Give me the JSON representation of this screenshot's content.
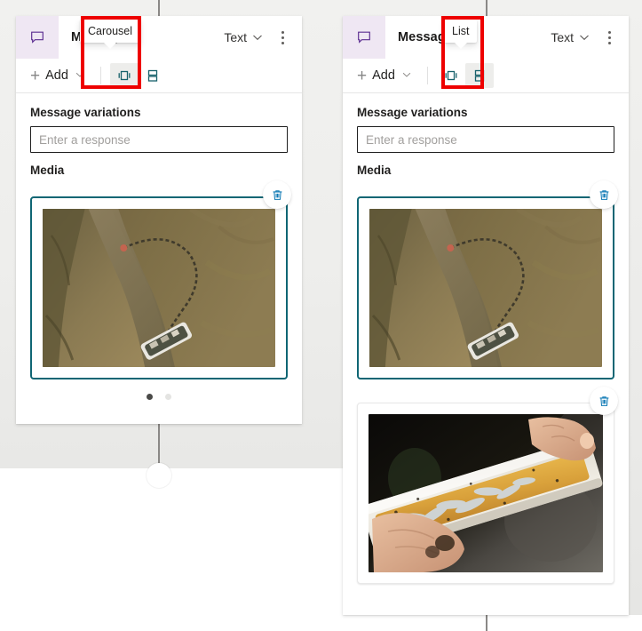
{
  "app": {
    "background_color": "#f1f1ef",
    "accent_teal": "#0f6674",
    "accent_blue": "#0078d4",
    "highlight_color": "#ee0000",
    "header_icon_bg": "#efe7f3",
    "header_icon_color": "#5c2e91"
  },
  "panels": [
    {
      "id": "left",
      "icon": "message-bubble-icon",
      "title": "Message",
      "type_label": "Text",
      "chevron_icon": "chevron-down-icon",
      "more_icon": "more-vertical-icon",
      "toolbar": {
        "add_label": "Add",
        "add_icon": "plus-icon",
        "add_chevron_icon": "chevron-down-icon",
        "carousel_icon": "carousel-layout-icon",
        "list_icon": "list-layout-icon",
        "selected_layout": "carousel"
      },
      "tooltip": {
        "text": "Carousel",
        "target": "carousel-layout-button"
      },
      "fields": {
        "variations_label": "Message variations",
        "response_value": "",
        "response_placeholder": "Enter a response",
        "media_label": "Media"
      },
      "media": [
        {
          "alt": "Aerial view of a fishing net curving from a sandy riverbank out to a small boat in brown water",
          "delete_icon": "trash-icon",
          "delete_label": "Delete",
          "selected": true
        }
      ],
      "pager": {
        "total": 2,
        "active_index": 0
      }
    },
    {
      "id": "right",
      "icon": "message-bubble-icon",
      "title": "Message",
      "type_label": "Text",
      "chevron_icon": "chevron-down-icon",
      "more_icon": "more-vertical-icon",
      "toolbar": {
        "add_label": "Add",
        "add_icon": "plus-icon",
        "add_chevron_icon": "chevron-down-icon",
        "carousel_icon": "carousel-layout-icon",
        "list_icon": "list-layout-icon",
        "selected_layout": "list"
      },
      "tooltip": {
        "text": "List",
        "target": "list-layout-button"
      },
      "fields": {
        "variations_label": "Message variations",
        "response_value": "",
        "response_placeholder": "Enter a response",
        "media_label": "Media"
      },
      "media": [
        {
          "alt": "Aerial view of a fishing net curving from a sandy riverbank out to a small boat in brown water",
          "delete_icon": "trash-icon",
          "delete_label": "Delete",
          "selected": true
        },
        {
          "alt": "Close-up of two hands holding a white plastic trough filled with small silver fish and amber liquid",
          "delete_icon": "trash-icon",
          "delete_label": "Delete",
          "selected": false
        }
      ]
    }
  ]
}
